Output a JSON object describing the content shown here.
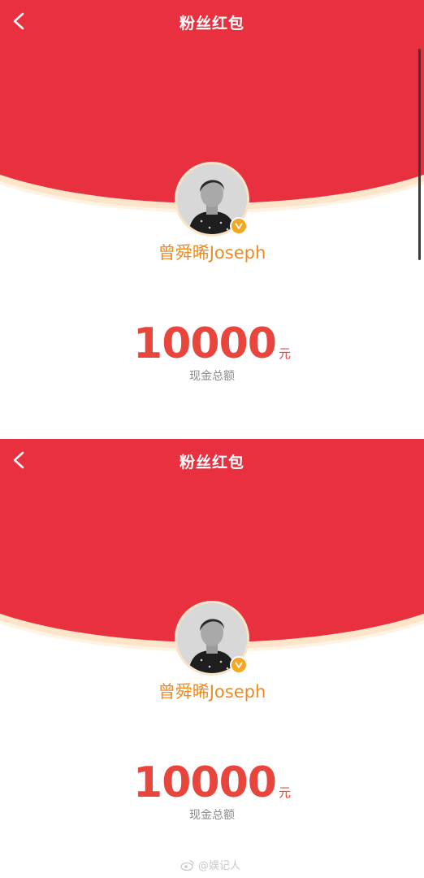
{
  "screens": [
    {
      "title": "粉丝红包",
      "username": "曾舜晞Joseph",
      "amount": "10000",
      "unit": "元",
      "amount_label": "现金总额"
    },
    {
      "title": "粉丝红包",
      "username": "曾舜晞Joseph",
      "amount": "10000",
      "unit": "元",
      "amount_label": "现金总额"
    }
  ],
  "watermark": "@娱记人",
  "colors": {
    "header_red": "#e8303e",
    "username_orange": "#f08a1f",
    "amount_red": "#e8453d",
    "verified_badge": "#f5a623"
  },
  "icons": {
    "back": "chevron-left-icon",
    "verified": "verified-badge-icon",
    "watermark": "weibo-icon"
  }
}
